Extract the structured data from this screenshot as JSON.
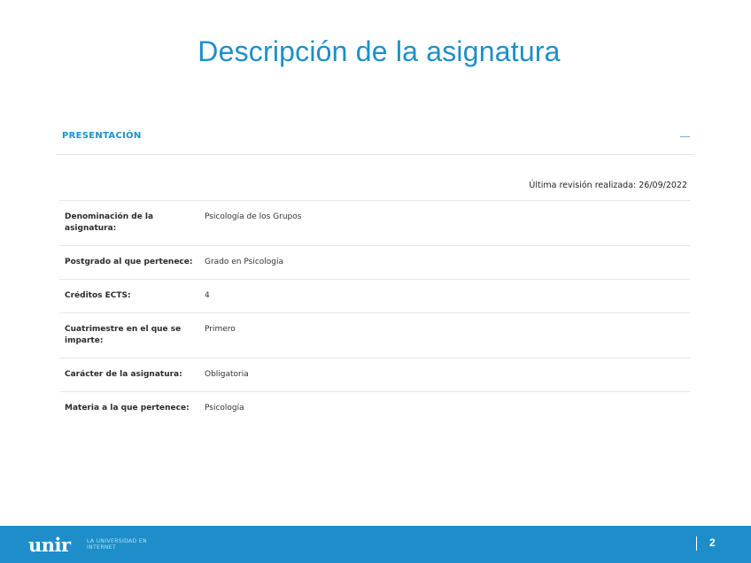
{
  "title": "Descripción de la asignatura",
  "section": {
    "label": "PRESENTACIÓN",
    "collapse_symbol": "—"
  },
  "revision": "Última revisión realizada: 26/09/2022",
  "rows": [
    {
      "label": "Denominación de la asignatura:",
      "value": "Psicología de los Grupos"
    },
    {
      "label": "Postgrado al que pertenece:",
      "value": "Grado en Psicología"
    },
    {
      "label": "Créditos ECTS:",
      "value": "4"
    },
    {
      "label": "Cuatrimestre en el que se imparte:",
      "value": "Primero"
    },
    {
      "label": "Carácter de la asignatura:",
      "value": "Obligatoria"
    },
    {
      "label": "Materia a la que pertenece:",
      "value": "Psicología"
    }
  ],
  "footer": {
    "logo_word": "unir",
    "logo_tagline": "LA UNIVERSIDAD EN INTERNET",
    "page_number": "2",
    "brand_color": "#1d8ec9"
  },
  "colors": {
    "title": "#1d8fc9",
    "accent": "#1d8fc9"
  }
}
